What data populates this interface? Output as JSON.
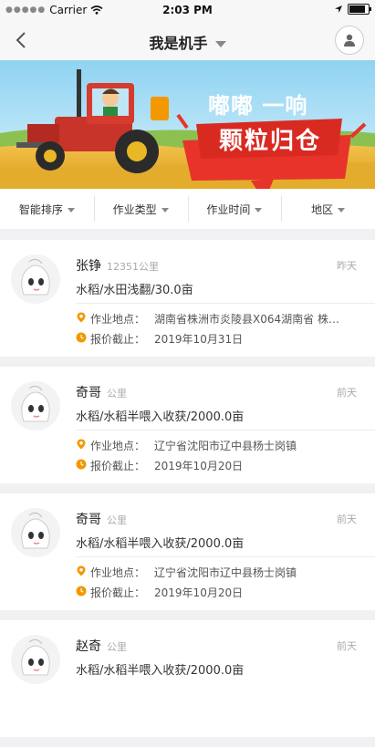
{
  "status_bar": {
    "carrier": "Carrier",
    "time": "2:03 PM"
  },
  "nav": {
    "title": "我是机手"
  },
  "banner": {
    "line1": "嘟嘟 一响",
    "line2": "颗粒归仓"
  },
  "filters": [
    "智能排序",
    "作业类型",
    "作业时间",
    "地区"
  ],
  "labels": {
    "location": "作业地点：",
    "deadline": "报价截止："
  },
  "cards": [
    {
      "name": "张铮",
      "distance": "12351公里",
      "time": "昨天",
      "desc": "水稻/水田浅翻/30.0亩",
      "location": "湖南省株洲市炎陵县X064湖南省 株…",
      "deadline": "2019年10月31日"
    },
    {
      "name": "奇哥",
      "distance": "公里",
      "time": "前天",
      "desc": "水稻/水稻半喂入收获/2000.0亩",
      "location": "辽宁省沈阳市辽中县杨士岗镇",
      "deadline": "2019年10月20日"
    },
    {
      "name": "奇哥",
      "distance": "公里",
      "time": "前天",
      "desc": "水稻/水稻半喂入收获/2000.0亩",
      "location": "辽宁省沈阳市辽中县杨士岗镇",
      "deadline": "2019年10月20日"
    },
    {
      "name": "赵奇",
      "distance": "公里",
      "time": "前天",
      "desc": "水稻/水稻半喂入收获/2000.0亩",
      "location": "",
      "deadline": ""
    }
  ],
  "colors": {
    "accent": "#f39800",
    "banner_red": "#e8332a",
    "sky": "#bfe6f7"
  }
}
